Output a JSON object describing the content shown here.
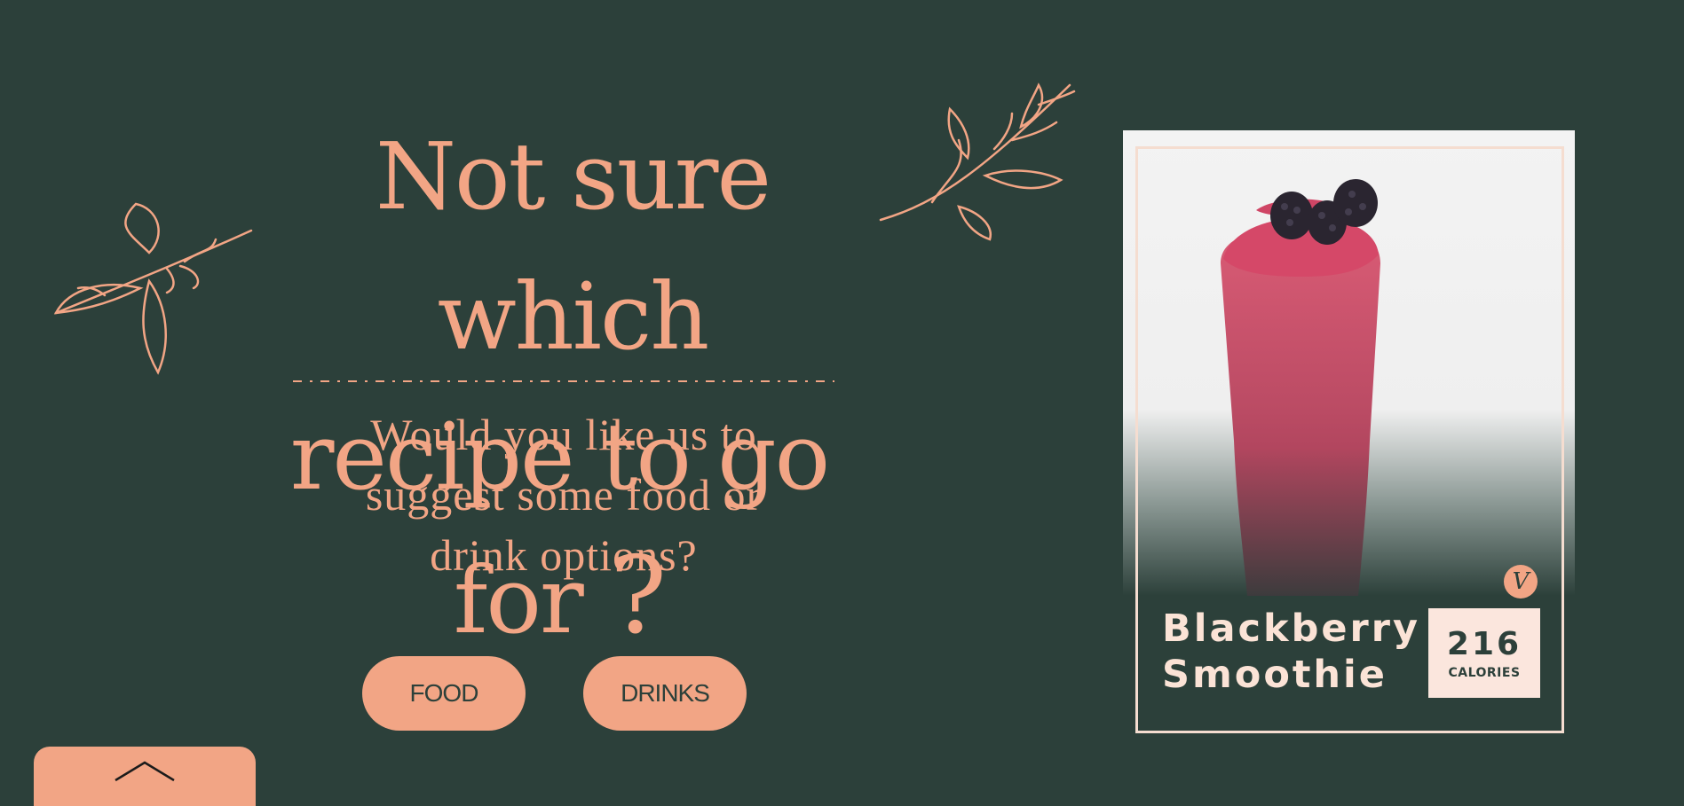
{
  "hero": {
    "headline_line1": "Not sure which",
    "headline_line2": "recipe to go for",
    "headline_qmark": "?",
    "subtitle_line1": "Would you like us to",
    "subtitle_line2": "suggest some food or",
    "subtitle_line3": "drink options?"
  },
  "buttons": {
    "food_label": "FOOD",
    "drinks_label": "DRINKS"
  },
  "back_tab": {
    "icon": "chevron-up-icon"
  },
  "card": {
    "name_line1": "Blackberry",
    "name_line2": "Smoothie",
    "calories_value": "216",
    "calories_label": "CALORIES",
    "badge_icon": "vegan-icon",
    "badge_glyph": "V"
  },
  "colors": {
    "background": "#2c403a",
    "accent": "#f2a585",
    "card_text": "#fbe3d6",
    "calorie_box": "#fbe6dd"
  }
}
